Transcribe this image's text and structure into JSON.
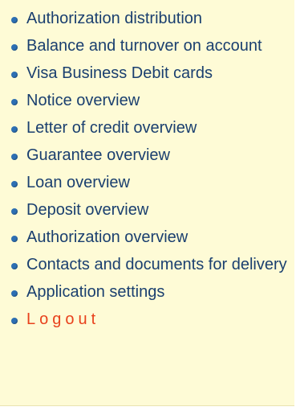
{
  "menu": {
    "items": [
      {
        "label": "Authorization distribution"
      },
      {
        "label": "Balance and turnover on account"
      },
      {
        "label": "Visa Business Debit cards"
      },
      {
        "label": "Notice overview"
      },
      {
        "label": "Letter of credit overview"
      },
      {
        "label": "Guarantee overview"
      },
      {
        "label": "Loan overview"
      },
      {
        "label": "Deposit overview"
      },
      {
        "label": "Authorization overview"
      },
      {
        "label": "Contacts and documents for delivery"
      },
      {
        "label": "Application settings"
      }
    ],
    "logout_label": "Logout"
  },
  "colors": {
    "background": "#fefbd6",
    "link_text": "#1a3f6f",
    "bullet": "#2d6fb3",
    "logout_text": "#e8411c"
  },
  "icons": {
    "bullet": "bullet-icon"
  }
}
